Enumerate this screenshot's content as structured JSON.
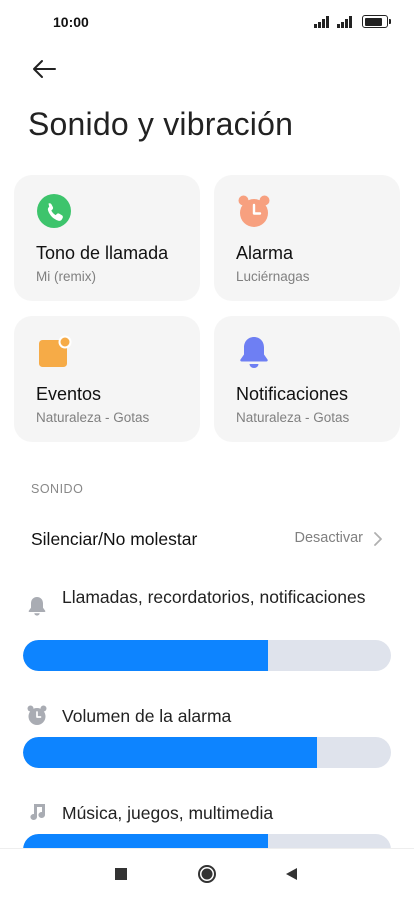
{
  "status_bar": {
    "time": "10:00",
    "battery_level": 0.85
  },
  "header": {
    "back_icon": "arrow-left-icon",
    "title": "Sonido y vibración"
  },
  "cards": [
    {
      "title": "Tono de llamada",
      "subtitle": "Mi (remix)",
      "icon": "phone-icon",
      "color": "#3dc46c"
    },
    {
      "title": "Alarma",
      "subtitle": "Luciérnagas",
      "icon": "alarm-clock-icon",
      "color": "#f7a07f"
    },
    {
      "title": "Eventos",
      "subtitle": "Naturaleza - Gotas",
      "icon": "calendar-event-icon",
      "color": "#f6ab47"
    },
    {
      "title": "Notificaciones",
      "subtitle": "Naturaleza - Gotas",
      "icon": "bell-icon",
      "color": "#6e7ff3"
    }
  ],
  "sound_section": {
    "header": "SONIDO",
    "dnd": {
      "label": "Silenciar/No molestar",
      "value": "Desactivar"
    },
    "volumes": [
      {
        "label": "Llamadas, recordatorios, notificaciones",
        "icon": "bell-icon",
        "level": 0.665
      },
      {
        "label": "Volumen de la alarma",
        "icon": "alarm-clock-icon",
        "level": 0.8
      },
      {
        "label": "Música, juegos, multimedia",
        "icon": "music-note-icon",
        "level": 0.665
      }
    ]
  },
  "nav_bar": {
    "buttons": [
      "recents-icon",
      "home-icon",
      "back-triangle-icon"
    ]
  },
  "colors": {
    "accent": "#0d84ff",
    "track": "#dfe3ec",
    "card_bg": "#f5f5f5"
  }
}
